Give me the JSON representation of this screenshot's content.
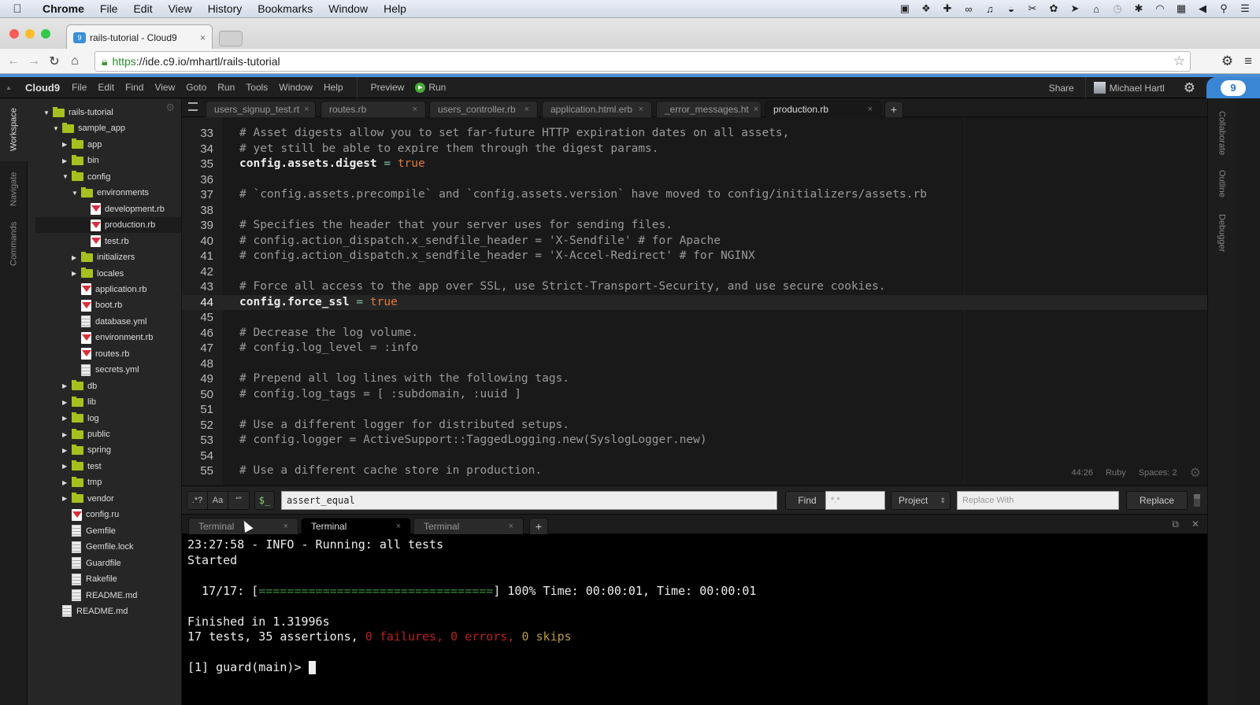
{
  "mac_menubar": {
    "apple": "",
    "app": "Chrome",
    "items": [
      "File",
      "Edit",
      "View",
      "History",
      "Bookmarks",
      "Window",
      "Help"
    ],
    "tray_icons": [
      "video-camera-icon",
      "dropbox-icon",
      "plugin-icon",
      "infinity-icon",
      "bell-icon",
      "bowl-icon",
      "tools-icon",
      "paw-icon",
      "arrow-icon",
      "home-icon",
      "time-machine-icon",
      "bluetooth-icon",
      "wifi-icon",
      "calendar-icon",
      "volume-icon",
      "spotlight-icon",
      "list-icon"
    ]
  },
  "browser": {
    "tab_title": "rails-tutorial - Cloud9",
    "tab_close": "×",
    "url_scheme": "https",
    "url_rest": "://ide.c9.io/mhartl/rails-tutorial",
    "star": "☆",
    "settings": "⚙",
    "menu": "≡"
  },
  "c9": {
    "brand": "Cloud9",
    "menu": [
      "File",
      "Edit",
      "Find",
      "View",
      "Goto",
      "Run",
      "Tools",
      "Window",
      "Help"
    ],
    "preview": "Preview",
    "run": "Run",
    "share": "Share",
    "user": "Michael Hartl",
    "cloud_badge": "9"
  },
  "left_tabs": [
    "Workspace",
    "Navigate",
    "Commands"
  ],
  "right_tabs": [
    "Collaborate",
    "Outline",
    "Debugger"
  ],
  "tree": [
    {
      "label": "rails-tutorial",
      "type": "folder",
      "open": true,
      "depth": 0
    },
    {
      "label": "sample_app",
      "type": "folder",
      "open": true,
      "depth": 1
    },
    {
      "label": "app",
      "type": "folder",
      "open": false,
      "depth": 2
    },
    {
      "label": "bin",
      "type": "folder",
      "open": false,
      "depth": 2
    },
    {
      "label": "config",
      "type": "folder",
      "open": true,
      "depth": 2
    },
    {
      "label": "environments",
      "type": "folder",
      "open": true,
      "depth": 3
    },
    {
      "label": "development.rb",
      "type": "ruby",
      "depth": 4
    },
    {
      "label": "production.rb",
      "type": "ruby",
      "depth": 4,
      "selected": true
    },
    {
      "label": "test.rb",
      "type": "ruby",
      "depth": 4
    },
    {
      "label": "initializers",
      "type": "folder",
      "open": false,
      "depth": 3
    },
    {
      "label": "locales",
      "type": "folder",
      "open": false,
      "depth": 3
    },
    {
      "label": "application.rb",
      "type": "ruby",
      "depth": 3
    },
    {
      "label": "boot.rb",
      "type": "ruby",
      "depth": 3
    },
    {
      "label": "database.yml",
      "type": "doc",
      "depth": 3
    },
    {
      "label": "environment.rb",
      "type": "ruby",
      "depth": 3
    },
    {
      "label": "routes.rb",
      "type": "ruby",
      "depth": 3
    },
    {
      "label": "secrets.yml",
      "type": "doc",
      "depth": 3
    },
    {
      "label": "db",
      "type": "folder",
      "open": false,
      "depth": 2
    },
    {
      "label": "lib",
      "type": "folder",
      "open": false,
      "depth": 2
    },
    {
      "label": "log",
      "type": "folder",
      "open": false,
      "depth": 2
    },
    {
      "label": "public",
      "type": "folder",
      "open": false,
      "depth": 2
    },
    {
      "label": "spring",
      "type": "folder",
      "open": false,
      "depth": 2
    },
    {
      "label": "test",
      "type": "folder",
      "open": false,
      "depth": 2
    },
    {
      "label": "tmp",
      "type": "folder",
      "open": false,
      "depth": 2
    },
    {
      "label": "vendor",
      "type": "folder",
      "open": false,
      "depth": 2
    },
    {
      "label": "config.ru",
      "type": "ruby",
      "depth": 2
    },
    {
      "label": "Gemfile",
      "type": "doc",
      "depth": 2
    },
    {
      "label": "Gemfile.lock",
      "type": "doc",
      "depth": 2
    },
    {
      "label": "Guardfile",
      "type": "doc",
      "depth": 2
    },
    {
      "label": "Rakefile",
      "type": "doc",
      "depth": 2
    },
    {
      "label": "README.md",
      "type": "doc",
      "depth": 2
    },
    {
      "label": "README.md",
      "type": "doc",
      "depth": 1
    }
  ],
  "editor_tabs": [
    {
      "label": "users_signup_test.rt",
      "active": false
    },
    {
      "label": "routes.rb",
      "active": false
    },
    {
      "label": "users_controller.rb",
      "active": false
    },
    {
      "label": "application.html.erb",
      "active": false
    },
    {
      "label": "_error_messages.ht",
      "active": false
    },
    {
      "label": "production.rb",
      "active": true
    }
  ],
  "code_lines": [
    {
      "n": "33",
      "parts": [
        [
          "cmt",
          "# Asset digests allow you to set far-future HTTP expiration dates on all assets,"
        ]
      ]
    },
    {
      "n": "34",
      "parts": [
        [
          "cmt",
          "# yet still be able to expire them through the digest params."
        ]
      ]
    },
    {
      "n": "35",
      "parts": [
        [
          "kw",
          "config.assets.digest"
        ],
        [
          "eq",
          " = "
        ],
        [
          "bool",
          "true"
        ]
      ]
    },
    {
      "n": "36",
      "parts": []
    },
    {
      "n": "37",
      "parts": [
        [
          "cmt",
          "# `config.assets.precompile` and `config.assets.version` have moved to config/initializers/assets.rb"
        ]
      ]
    },
    {
      "n": "38",
      "parts": []
    },
    {
      "n": "39",
      "parts": [
        [
          "cmt",
          "# Specifies the header that your server uses for sending files."
        ]
      ]
    },
    {
      "n": "40",
      "parts": [
        [
          "cmt",
          "# config.action_dispatch.x_sendfile_header = 'X-Sendfile' # for Apache"
        ]
      ]
    },
    {
      "n": "41",
      "parts": [
        [
          "cmt",
          "# config.action_dispatch.x_sendfile_header = 'X-Accel-Redirect' # for NGINX"
        ]
      ]
    },
    {
      "n": "42",
      "parts": []
    },
    {
      "n": "43",
      "parts": [
        [
          "cmt",
          "# Force all access to the app over SSL, use Strict-Transport-Security, and use secure cookies."
        ]
      ]
    },
    {
      "n": "44",
      "parts": [
        [
          "kw",
          "config.force_ssl"
        ],
        [
          "eq",
          " = "
        ],
        [
          "bool",
          "true"
        ]
      ],
      "current": true
    },
    {
      "n": "45",
      "parts": []
    },
    {
      "n": "46",
      "parts": [
        [
          "cmt",
          "# Decrease the log volume."
        ]
      ]
    },
    {
      "n": "47",
      "parts": [
        [
          "cmt",
          "# config.log_level = :info"
        ]
      ]
    },
    {
      "n": "48",
      "parts": []
    },
    {
      "n": "49",
      "parts": [
        [
          "cmt",
          "# Prepend all log lines with the following tags."
        ]
      ]
    },
    {
      "n": "50",
      "parts": [
        [
          "cmt",
          "# config.log_tags = [ :subdomain, :uuid ]"
        ]
      ]
    },
    {
      "n": "51",
      "parts": []
    },
    {
      "n": "52",
      "parts": [
        [
          "cmt",
          "# Use a different logger for distributed setups."
        ]
      ]
    },
    {
      "n": "53",
      "parts": [
        [
          "cmt",
          "# config.logger = ActiveSupport::TaggedLogging.new(SyslogLogger.new)"
        ]
      ]
    },
    {
      "n": "54",
      "parts": []
    },
    {
      "n": "55",
      "parts": [
        [
          "cmt",
          "# Use a different cache store in production."
        ]
      ]
    }
  ],
  "status": {
    "cursor": "44:26",
    "mode": "Ruby",
    "indent": "Spaces: 2"
  },
  "find": {
    "regex": ".*?",
    "case": "Aa",
    "word": "“”",
    "console": "$_",
    "query": "assert_equal",
    "find_label": "Find",
    "files_placeholder": "*.*",
    "scope": "Project",
    "replace_placeholder": "Replace With",
    "replace_label": "Replace"
  },
  "terminal_tabs": [
    {
      "label": "Terminal",
      "active": false
    },
    {
      "label": "Terminal",
      "active": true
    },
    {
      "label": "Terminal",
      "active": false
    }
  ],
  "terminal": {
    "line1": "23:27:58 - INFO - Running: all tests",
    "line2": "Started",
    "progress_prefix": "  17/17: [",
    "progress_bar": "=================================",
    "progress_suffix": "] 100% Time: 00:00:01, Time: 00:00:01",
    "progress_percent": 100,
    "finished": "Finished in 1.31996s",
    "summary_prefix": "17 tests, 35 assertions, ",
    "failures": "0 failures, 0 errors, ",
    "skips": "0 skips",
    "prompt": "[1] guard(main)> "
  }
}
